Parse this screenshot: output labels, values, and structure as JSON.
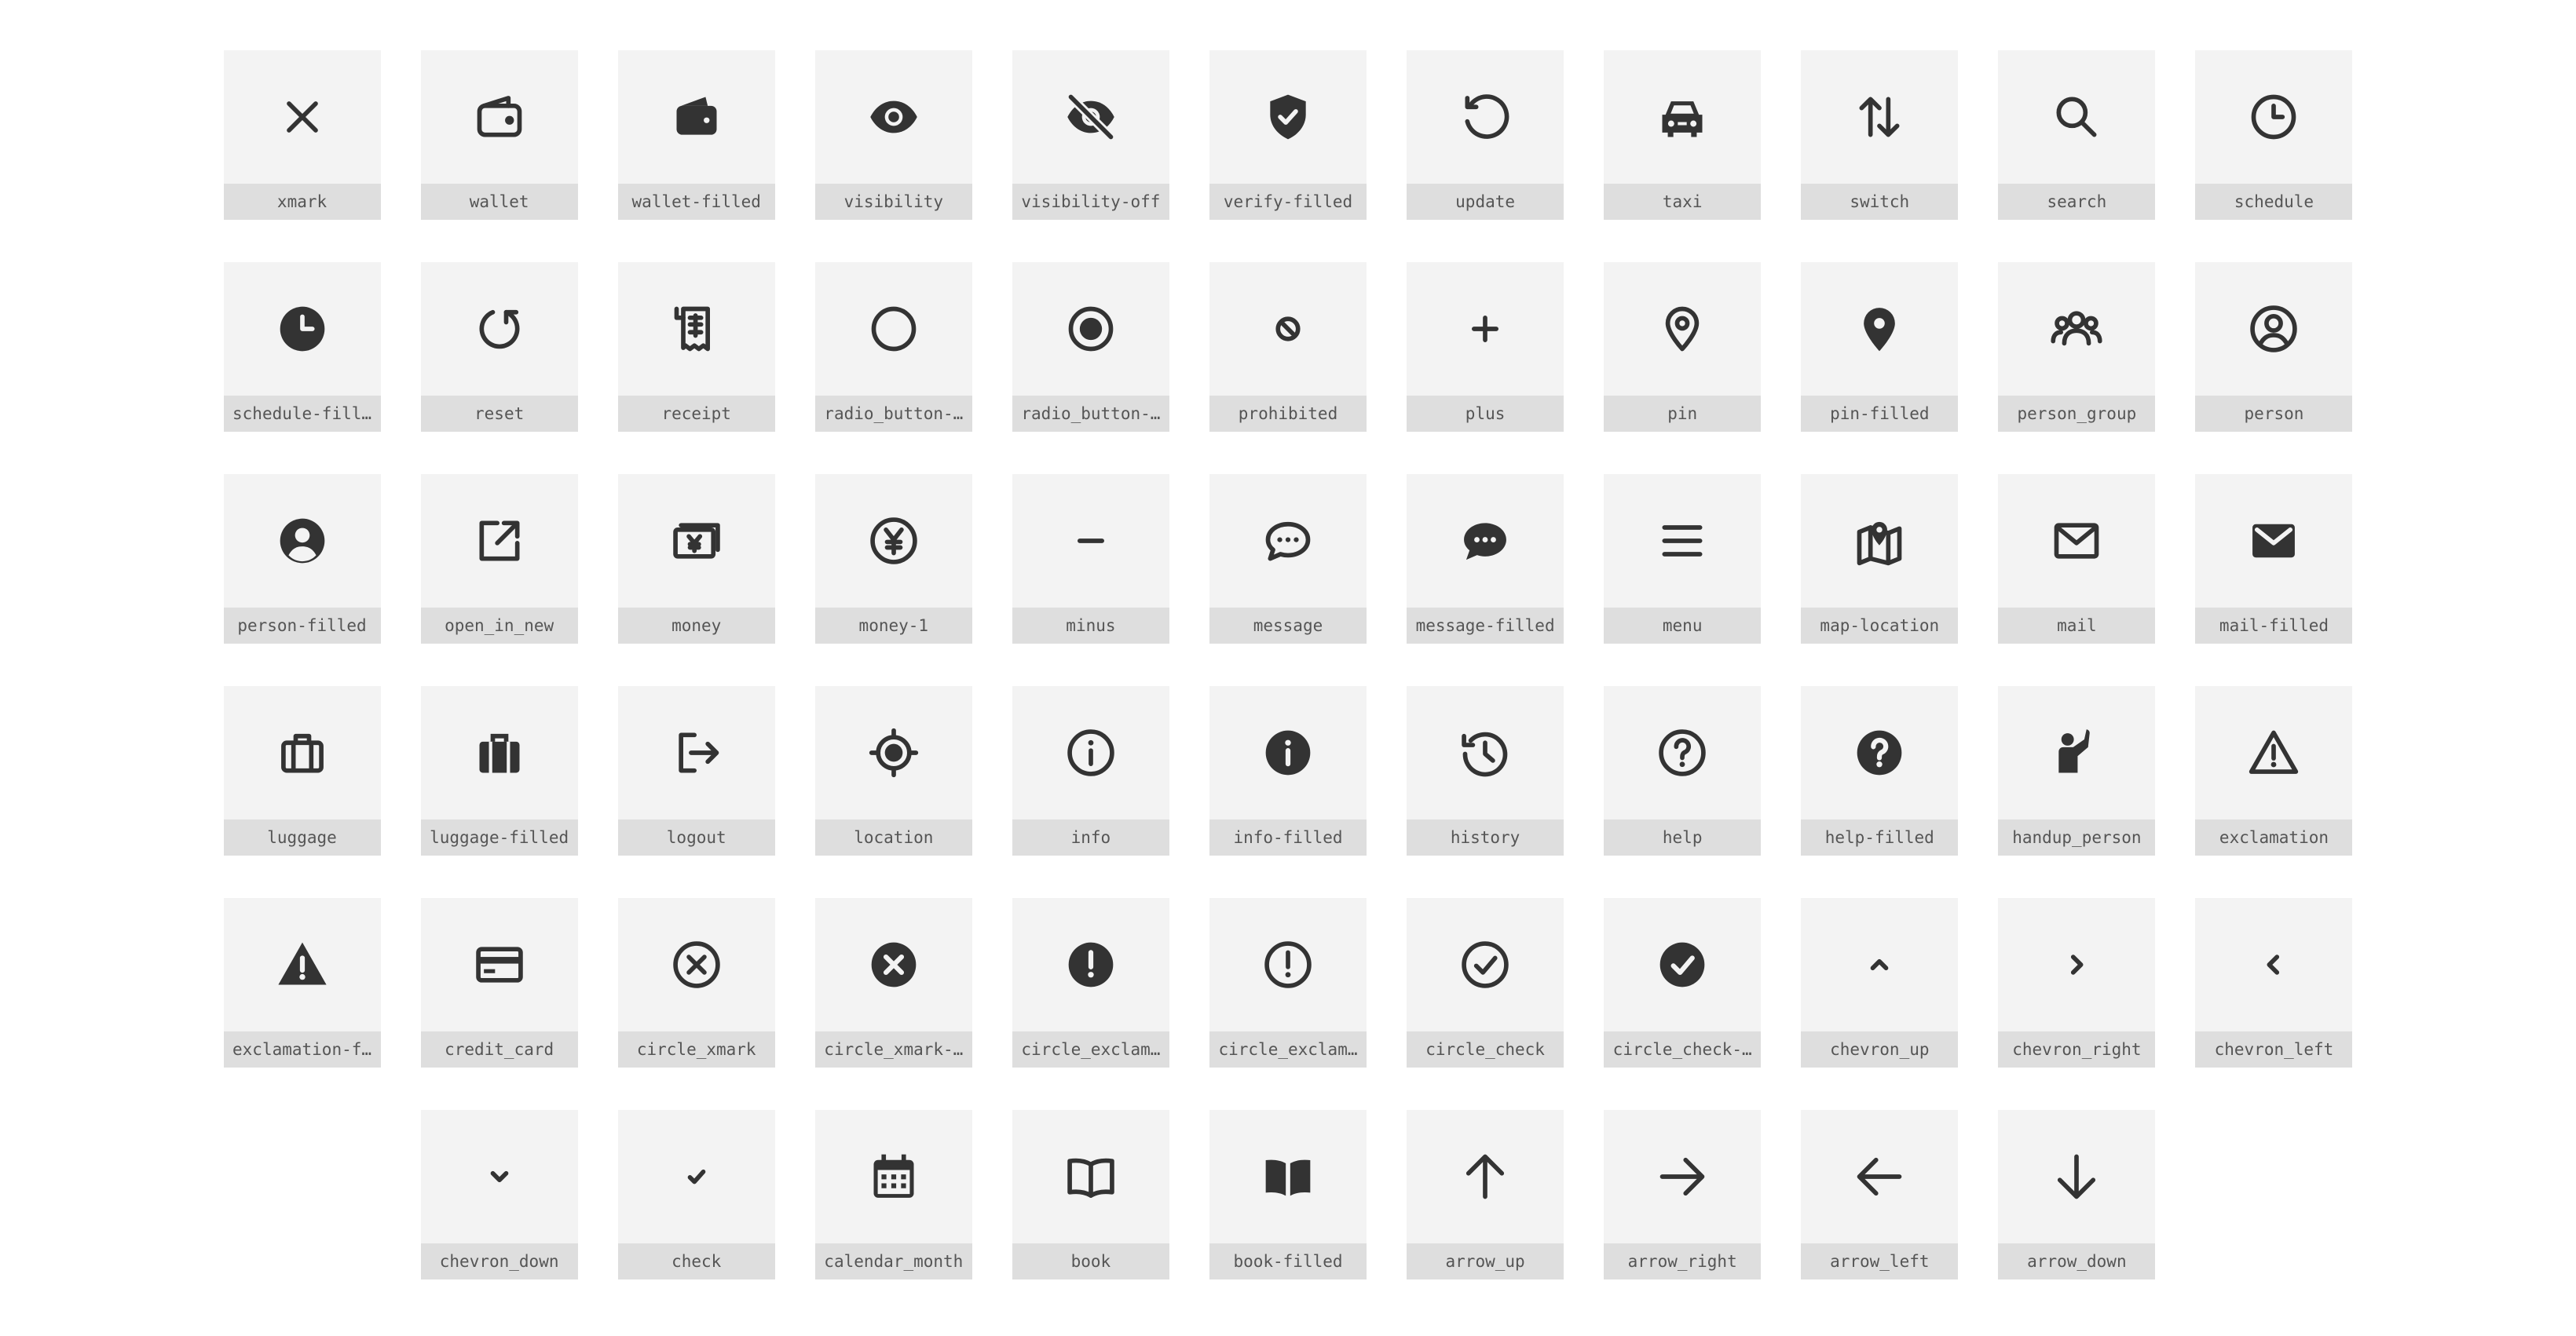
{
  "colors": {
    "tile_background": "#f3f3f3",
    "label_background": "#dedede",
    "icon": "#333333",
    "label_text": "#555555"
  },
  "icons": [
    {
      "name": "xmark",
      "label": "xmark"
    },
    {
      "name": "wallet",
      "label": "wallet"
    },
    {
      "name": "wallet-filled",
      "label": "wallet-filled"
    },
    {
      "name": "visibility",
      "label": "visibility"
    },
    {
      "name": "visibility-off",
      "label": "visibility-off"
    },
    {
      "name": "verify-filled",
      "label": "verify-filled"
    },
    {
      "name": "update",
      "label": "update"
    },
    {
      "name": "taxi",
      "label": "taxi"
    },
    {
      "name": "switch",
      "label": "switch"
    },
    {
      "name": "search",
      "label": "search"
    },
    {
      "name": "schedule",
      "label": "schedule"
    },
    {
      "name": "schedule-filled",
      "label": "schedule-fill…"
    },
    {
      "name": "reset",
      "label": "reset"
    },
    {
      "name": "receipt",
      "label": "receipt"
    },
    {
      "name": "radio-button-unchecked",
      "label": "radio_button-…"
    },
    {
      "name": "radio-button-checked",
      "label": "radio_button-…"
    },
    {
      "name": "prohibited",
      "label": "prohibited"
    },
    {
      "name": "plus",
      "label": "plus"
    },
    {
      "name": "pin",
      "label": "pin"
    },
    {
      "name": "pin-filled",
      "label": "pin-filled"
    },
    {
      "name": "person-group",
      "label": "person_group"
    },
    {
      "name": "person",
      "label": "person"
    },
    {
      "name": "person-filled",
      "label": "person-filled"
    },
    {
      "name": "open-in-new",
      "label": "open_in_new"
    },
    {
      "name": "money",
      "label": "money"
    },
    {
      "name": "money-1",
      "label": "money-1"
    },
    {
      "name": "minus",
      "label": "minus"
    },
    {
      "name": "message",
      "label": "message"
    },
    {
      "name": "message-filled",
      "label": "message-filled"
    },
    {
      "name": "menu",
      "label": "menu"
    },
    {
      "name": "map-location",
      "label": "map-location"
    },
    {
      "name": "mail",
      "label": "mail"
    },
    {
      "name": "mail-filled",
      "label": "mail-filled"
    },
    {
      "name": "luggage",
      "label": "luggage"
    },
    {
      "name": "luggage-filled",
      "label": "luggage-filled"
    },
    {
      "name": "logout",
      "label": "logout"
    },
    {
      "name": "location",
      "label": "location"
    },
    {
      "name": "info",
      "label": "info"
    },
    {
      "name": "info-filled",
      "label": "info-filled"
    },
    {
      "name": "history",
      "label": "history"
    },
    {
      "name": "help",
      "label": "help"
    },
    {
      "name": "help-filled",
      "label": "help-filled"
    },
    {
      "name": "handup-person",
      "label": "handup_person"
    },
    {
      "name": "exclamation",
      "label": "exclamation"
    },
    {
      "name": "exclamation-filled",
      "label": "exclamation-f…"
    },
    {
      "name": "credit-card",
      "label": "credit_card"
    },
    {
      "name": "circle-xmark",
      "label": "circle_xmark"
    },
    {
      "name": "circle-xmark-filled",
      "label": "circle_xmark-…"
    },
    {
      "name": "circle-exclamation-filled",
      "label": "circle_exclam…"
    },
    {
      "name": "circle-exclamation",
      "label": "circle_exclam…"
    },
    {
      "name": "circle-check",
      "label": "circle_check"
    },
    {
      "name": "circle-check-filled",
      "label": "circle_check-…"
    },
    {
      "name": "chevron-up",
      "label": "chevron_up"
    },
    {
      "name": "chevron-right",
      "label": "chevron_right"
    },
    {
      "name": "chevron-left",
      "label": "chevron_left"
    },
    {
      "name": "chevron-down",
      "label": "chevron_down"
    },
    {
      "name": "check",
      "label": "check"
    },
    {
      "name": "calendar-month",
      "label": "calendar_month"
    },
    {
      "name": "book",
      "label": "book"
    },
    {
      "name": "book-filled",
      "label": "book-filled"
    },
    {
      "name": "arrow-up",
      "label": "arrow_up"
    },
    {
      "name": "arrow-right",
      "label": "arrow_right"
    },
    {
      "name": "arrow-left",
      "label": "arrow_left"
    },
    {
      "name": "arrow-down",
      "label": "arrow_down"
    }
  ]
}
